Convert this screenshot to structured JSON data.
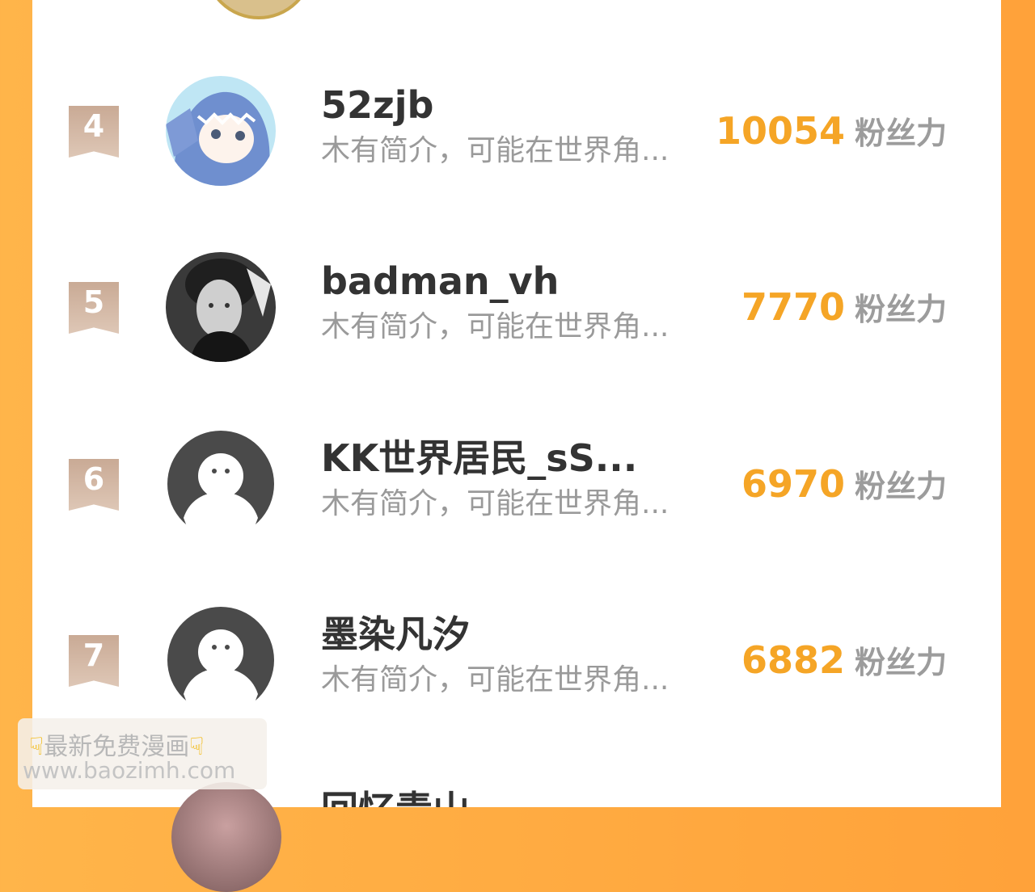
{
  "ranking": [
    {
      "rank": "4",
      "name": "52zjb",
      "bio": "木有简介，可能在世界角...",
      "score": "10054",
      "unit": "粉丝力",
      "avatar": "anime-shark-hood-avatar"
    },
    {
      "rank": "5",
      "name": "badman_vh",
      "bio": "木有简介，可能在世界角...",
      "score": "7770",
      "unit": "粉丝力",
      "avatar": "photo-portrait-avatar"
    },
    {
      "rank": "6",
      "name": "KK世界居民_sS...",
      "bio": "木有简介，可能在世界角...",
      "score": "6970",
      "unit": "粉丝力",
      "avatar": "default-ghost-avatar"
    },
    {
      "rank": "7",
      "name": "墨染凡汐",
      "bio": "木有简介，可能在世界角...",
      "score": "6882",
      "unit": "粉丝力",
      "avatar": "default-ghost-avatar"
    }
  ],
  "next_partial": {
    "name": "回忆青山"
  },
  "watermark": {
    "line1": "最新免费漫画",
    "line2": "www.baozimh.com",
    "icon": "pointing-down-hand-emoji"
  },
  "colors": {
    "background": "#ffa23a",
    "score": "#f5a526",
    "rank_badge": "#cfb29d"
  }
}
